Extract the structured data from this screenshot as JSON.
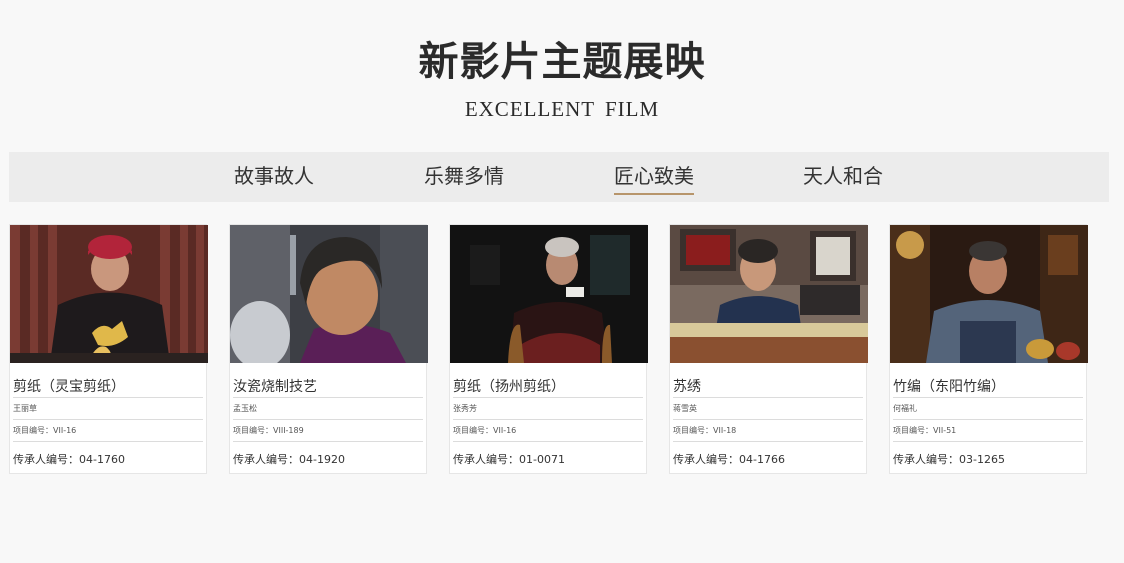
{
  "header": {
    "title": "新影片主题展映",
    "subtitle": "EXCELLENT  FILM"
  },
  "tabs": [
    {
      "label": "故事故人",
      "active": false
    },
    {
      "label": "乐舞多情",
      "active": false
    },
    {
      "label": "匠心致美",
      "active": true
    },
    {
      "label": "天人和合",
      "active": false
    }
  ],
  "accent_color": "#b7956b",
  "cards": [
    {
      "title": "剪纸（灵宝剪纸）",
      "name": "王丽草",
      "project": "项目编号：VII-16",
      "heir": "传承人编号：04-1760"
    },
    {
      "title": "汝瓷烧制技艺",
      "name": "孟玉松",
      "project": "项目编号：VIII-189",
      "heir": "传承人编号：04-1920"
    },
    {
      "title": "剪纸（扬州剪纸）",
      "name": "张秀芳",
      "project": "项目编号：VII-16",
      "heir": "传承人编号：01-0071"
    },
    {
      "title": "苏绣",
      "name": "蒋雪英",
      "project": "项目编号：VII-18",
      "heir": "传承人编号：04-1766"
    },
    {
      "title": "竹编（东阳竹编）",
      "name": "何福礼",
      "project": "项目编号：VII-51",
      "heir": "传承人编号：03-1265"
    }
  ]
}
